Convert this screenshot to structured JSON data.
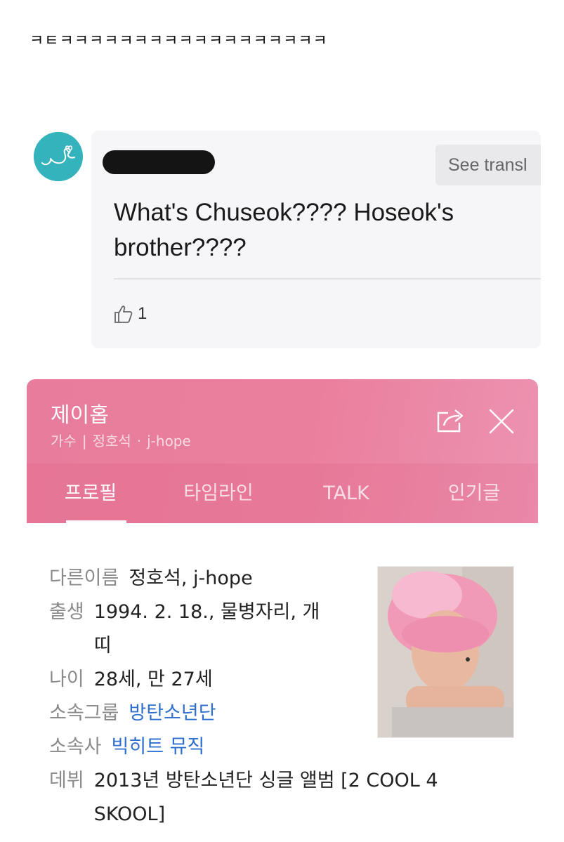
{
  "caption": "ㅋㅌㅋㅋㅋㅋㅋㅋㅋㅋㅋㅋㅋㅋㅋㅋㅋㅋㅋㅋ",
  "comment": {
    "translate_label": "See transl",
    "text": "What's Chuseok???? Hoseok's brother????",
    "like_count": "1"
  },
  "profile": {
    "name": "제이홉",
    "sub": [
      "가수",
      "정호석",
      "j-hope"
    ],
    "tabs": [
      "프로필",
      "타임라인",
      "TALK",
      "인기글"
    ],
    "info": [
      {
        "key": "다른이름",
        "value": "정호석, j-hope"
      },
      {
        "key": "출생",
        "value": "1994. 2. 18., 물병자리, 개띠"
      },
      {
        "key": "나이",
        "value": "28세, 만 27세"
      },
      {
        "key": "소속그룹",
        "value": "방탄소년단"
      },
      {
        "key": "소속사",
        "value": "빅히트 뮤직"
      },
      {
        "key": "데뷔",
        "value": "2013년 방탄소년단 싱글 앨범 [2 COOL 4 SKOOL]"
      }
    ]
  },
  "colors": {
    "header_pink": "#e87c9c",
    "link_blue": "#2f6fd0",
    "avatar_teal": "#35b3bd"
  }
}
